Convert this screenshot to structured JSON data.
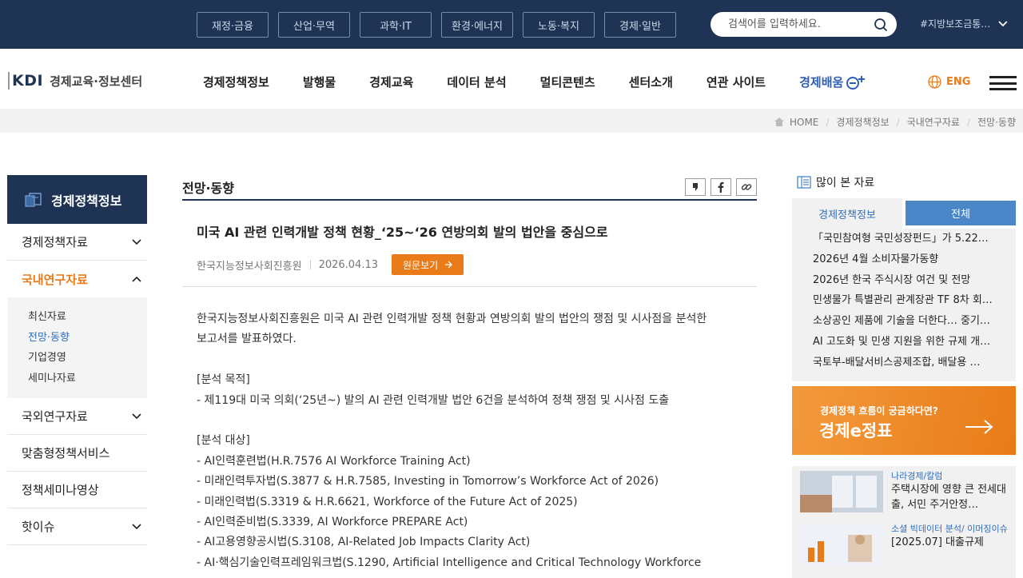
{
  "topbar": {
    "categories": [
      "재정·금융",
      "산업·무역",
      "과학·IT",
      "환경·에너지",
      "노동·복지",
      "경제·일반"
    ],
    "search_placeholder": "검색어를 입력하세요.",
    "hashtag": "#지방보조금통…"
  },
  "header": {
    "logo_kdi": "KDI",
    "logo_name": "경제교육·정보센터",
    "nav": [
      "경제정책정보",
      "발행물",
      "경제교육",
      "데이터 분석",
      "멀티콘텐츠",
      "센터소개",
      "연관 사이트"
    ],
    "nav_special": "경제배움",
    "lang": "ENG"
  },
  "breadcrumb": [
    "HOME",
    "경제정책정보",
    "국내연구자료",
    "전망·동향"
  ],
  "lnb": {
    "title": "경제정책정보",
    "items": [
      "경제정책자료",
      "국내연구자료",
      "국외연구자료",
      "맞춤형정책서비스",
      "정책세미나영상",
      "핫이슈"
    ],
    "sub": [
      "최신자료",
      "전망·동향",
      "기업경영",
      "세미나자료"
    ]
  },
  "article": {
    "section": "전망·동향",
    "title": "미국 AI 관련 인력개발 정책 현황_‘25~‘26 연방의회 발의 법안을 중심으로",
    "source": "한국지능정보사회진흥원",
    "date": "2026.04.13",
    "source_button": "원문보기",
    "body": [
      "한국지능정보사회진흥원은 미국 AI 관련 인력개발 정책 현황과 연방의회 발의 법안의 쟁점 및 시사점을 분석한",
      "보고서를 발표하였다.",
      "",
      "[분석 목적]",
      "- 제119대 미국 의회(‘25년~) 발의 AI 관련 인력개발 법안 6건을 분석하여 정책 쟁점 및 시사점 도출",
      "",
      "[분석 대상]",
      "- AI인력훈련법(H.R.7576 AI Workforce Training Act)",
      "- 미래인력투자법(S.3877 & H.R.7585, Investing in Tomorrow’s Workforce Act of 2026)",
      "- 미래인력법(S.3319 & H.R.6621, Workforce of the Future Act of 2025)",
      "- AI인력준비법(S.3339, AI Workforce PREPARE Act)",
      "- AI고용영향공시법(S.3108, AI-Related Job Impacts Clarity Act)",
      "- AI·핵심기술인력프레임워크법(S.1290, Artificial Intelligence and Critical Technology Workforce"
    ]
  },
  "sidebar": {
    "popular_title": "많이 본 자료",
    "tabs": [
      "경제정책정보",
      "전체"
    ],
    "popular": [
      "「국민참여형 국민성장펀드」가 5.22일(…",
      "2026년 4월 소비자물가동향",
      "2026년 한국 주식시장 여건 및 전망",
      "민생물가 특별관리 관계장관 TF 8차 회…",
      "소상공인 제품에 기술을 더한다… 중기…",
      "AI 고도화 및 민생 지원을 위한 규제 개…",
      "국토부-배달서비스공제조합, 배달용 …"
    ],
    "banner_small": "경제정책 흐름이 궁금하다면?",
    "banner_big": "경제e정표",
    "cards": [
      {
        "cat": "나라경제/칼럼",
        "title": "주택시장에 영향 큰 전세대출, 서민 주거안정…"
      },
      {
        "cat": "소셜 빅데이터 분석/ 이머징이슈",
        "title": "[2025.07] 대출규제"
      }
    ]
  },
  "colors": {
    "navy": "#1f3454",
    "orange": "#e97b18",
    "blue": "#2f6fc0"
  }
}
